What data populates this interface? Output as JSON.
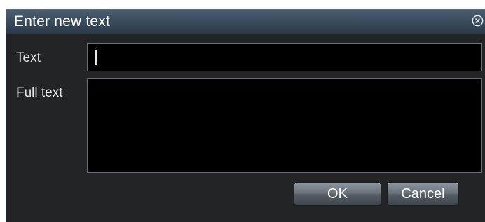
{
  "dialog": {
    "title": "Enter new text",
    "close_icon": "close-circle-icon",
    "text_label": "Text",
    "text_value": "",
    "full_text_label": "Full text",
    "full_text_value": "",
    "ok_label": "OK",
    "cancel_label": "Cancel"
  },
  "colors": {
    "titlebar": "#3a4c5e",
    "background": "#222426",
    "field": "#000000",
    "text": "#ffffff"
  }
}
